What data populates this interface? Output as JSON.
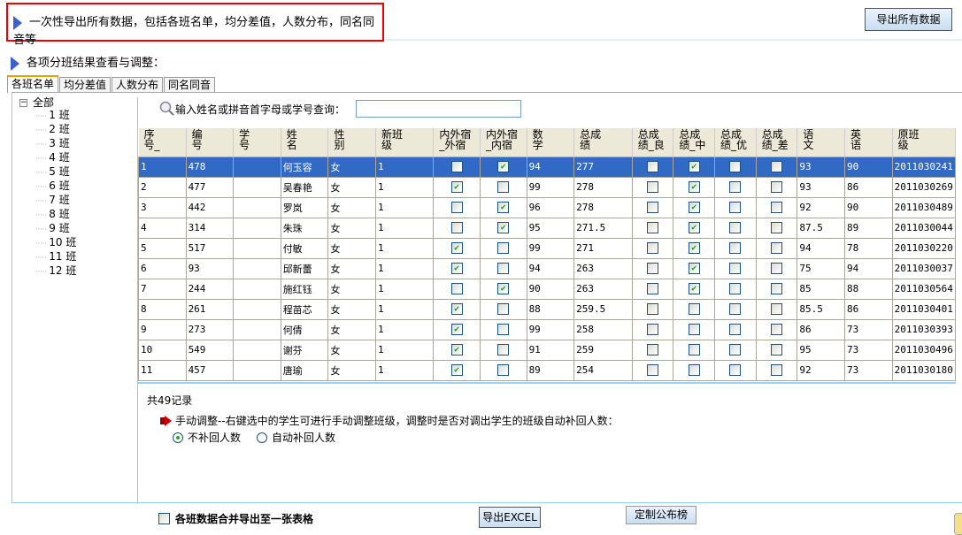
{
  "header": {
    "notice": "一次性导出所有数据，包括各班名单，均分差值，人数分布，同名同音等",
    "export_all": "导出所有数据"
  },
  "section_title": "各项分班结果查看与调整：",
  "tabs": [
    "各班名单",
    "均分差值",
    "人数分布",
    "同名同音"
  ],
  "tree": {
    "root": "全部",
    "items": [
      "1 班",
      "2 班",
      "3 班",
      "4 班",
      "5 班",
      "6 班",
      "7 班",
      "8 班",
      "9 班",
      "10 班",
      "11 班",
      "12 班"
    ]
  },
  "search": {
    "label": "输入姓名或拼音首字母或学号查询：",
    "value": ""
  },
  "table": {
    "columns": [
      "序号_",
      "编号",
      "学号",
      "姓名",
      "性别",
      "新班级",
      "内外宿_外宿",
      "内外宿_内宿",
      "数学",
      "总成绩",
      "总成绩_良",
      "总成绩_中",
      "总成绩_优",
      "总成绩_差",
      "语文",
      "英语",
      "原班级"
    ],
    "columns_display": [
      "序<br>号_",
      "编<br>号",
      "学<br>号",
      "姓<br>名",
      "性<br>别",
      "新班<br>级",
      "内外宿<br>_外宿",
      "内外宿<br>_内宿",
      "数<br>学",
      "总成<br>绩",
      "总成<br>绩_良",
      "总成<br>绩_中",
      "总成<br>绩_优",
      "总成<br>绩_差",
      "语<br>文",
      "英<br>语",
      "原班<br>级"
    ],
    "selected_row": 0,
    "rows": [
      [
        "1",
        "478",
        "",
        "何玉容",
        "女",
        "1",
        false,
        true,
        "94",
        "277",
        false,
        true,
        false,
        false,
        "93",
        "90",
        "2011030241"
      ],
      [
        "2",
        "477",
        "",
        "吴春艳",
        "女",
        "1",
        true,
        false,
        "99",
        "278",
        false,
        true,
        false,
        false,
        "93",
        "86",
        "2011030269"
      ],
      [
        "3",
        "442",
        "",
        "罗岚",
        "女",
        "1",
        false,
        true,
        "96",
        "278",
        false,
        true,
        false,
        false,
        "92",
        "90",
        "2011030489"
      ],
      [
        "4",
        "314",
        "",
        "朱珠",
        "女",
        "1",
        false,
        true,
        "95",
        "271.5",
        false,
        true,
        false,
        false,
        "87.5",
        "89",
        "2011030044"
      ],
      [
        "5",
        "517",
        "",
        "付敏",
        "女",
        "1",
        true,
        false,
        "99",
        "271",
        false,
        true,
        false,
        false,
        "94",
        "78",
        "2011030220"
      ],
      [
        "6",
        "93",
        "",
        "邱新蕾",
        "女",
        "1",
        true,
        false,
        "94",
        "263",
        false,
        true,
        false,
        false,
        "75",
        "94",
        "2011030037"
      ],
      [
        "7",
        "244",
        "",
        "施红钰",
        "女",
        "1",
        false,
        true,
        "90",
        "263",
        false,
        true,
        false,
        false,
        "85",
        "88",
        "2011030564"
      ],
      [
        "8",
        "261",
        "",
        "程苗芯",
        "女",
        "1",
        true,
        false,
        "88",
        "259.5",
        false,
        false,
        false,
        false,
        "85.5",
        "86",
        "2011030401"
      ],
      [
        "9",
        "273",
        "",
        "何倩",
        "女",
        "1",
        true,
        false,
        "99",
        "258",
        false,
        false,
        false,
        false,
        "86",
        "73",
        "2011030393"
      ],
      [
        "10",
        "549",
        "",
        "谢芬",
        "女",
        "1",
        true,
        false,
        "91",
        "259",
        false,
        false,
        false,
        false,
        "95",
        "73",
        "2011030496"
      ],
      [
        "11",
        "457",
        "",
        "唐瑜",
        "女",
        "1",
        true,
        false,
        "89",
        "254",
        false,
        false,
        false,
        false,
        "92",
        "73",
        "2011030180"
      ]
    ]
  },
  "record_count": "共49记录",
  "manual_note": "手动调整--右键选中的学生可进行手动调整班级，调整时是否对调出学生的班级自动补回人数：",
  "radios": [
    {
      "label": "不补回人数",
      "checked": true
    },
    {
      "label": "自动补回人数",
      "checked": false
    }
  ],
  "merge_label": "各班数据合并导出至一张表格",
  "export_excel": "导出EXCEL",
  "custom_board": "定制公布榜"
}
